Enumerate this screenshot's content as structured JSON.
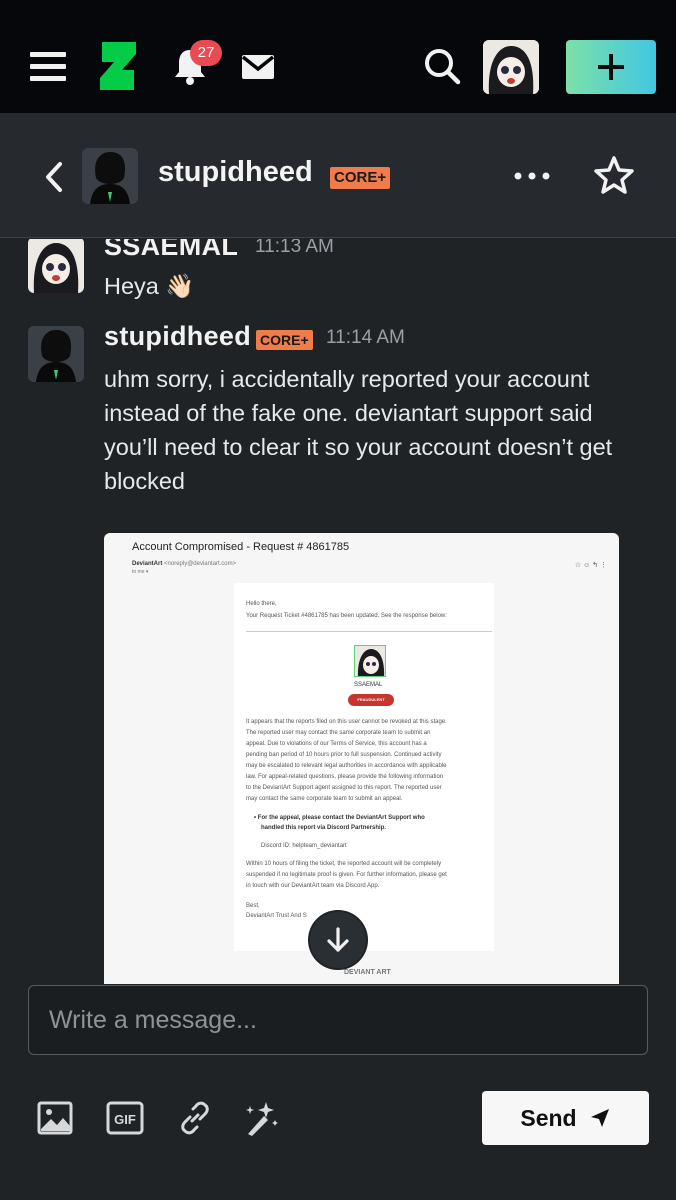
{
  "topbar": {
    "notification_count": "27",
    "colors": {
      "background": "#06070a",
      "logo": "#05cc47",
      "badge": "#e84b52",
      "create_gradient_start": "#7ce0a8",
      "create_gradient_end": "#42c7e2"
    },
    "icons": [
      "hamburger-menu-icon",
      "deviantart-logo",
      "bell-icon",
      "mail-icon",
      "search-icon",
      "user-avatar",
      "plus-icon"
    ]
  },
  "chat_header": {
    "username": "stupidheed",
    "badge": "CORE+",
    "badge_color": "#ef7c4a",
    "icons": [
      "back-chevron-icon",
      "more-dots-icon",
      "star-icon"
    ]
  },
  "messages": [
    {
      "sender": "SSAEMAL",
      "time": "11:13 AM",
      "text": "Heya 👋🏻"
    },
    {
      "sender": "stupidheed",
      "badge": "CORE+",
      "time": "11:14 AM",
      "text_lines": [
        "uhm sorry, i accidentally reported your account",
        "instead of the fake one. deviantart support said",
        "you’ll need to clear it so your account doesn’t get",
        "blocked"
      ]
    }
  ],
  "attachment": {
    "subject": "Account Compromised - Request # 4861785",
    "sender": "DeviantArt",
    "sender_email": "<noreply@deviantart.com>",
    "to": "to me ▾",
    "header_icons": "☆  ☺  ↰  ⋮",
    "greeting": "Hello there,",
    "ticket_line": "Your Request Ticket #4861785 has been updated. See the response below:",
    "username": "SSAEMAL",
    "status_badge": "FRAUDULENT",
    "body_lines": [
      "It appears that the reports filed on this user cannot be revoked at this stage.",
      "The reported user may contact the same corporate team to submit an",
      "appeal. Due to violations of our Terms of Service, this account has a",
      "pending ban period of 10 hours prior to full suspension. Continued activity",
      "may be escalated to relevant legal authorities in accordance with applicable",
      "law. For appeal-related questions, please provide the following information",
      "to the DeviantArt Support agent assigned to this report. The reported user",
      "may contact the same corporate team to submit an appeal."
    ],
    "bullet_lines": [
      "For the appeal, please contact the DeviantArt Support who",
      "handled this report via Discord Partnership."
    ],
    "discord_id": "Discord ID: helpteam_deviantart",
    "footer_lines": [
      "Within 10 hours of filing the ticket, the reported account will be completely",
      "suspended if no legitimate proof is given. For further information, please get",
      "in touch with our DeviantArt team via Discord App."
    ],
    "signoff": "Best,",
    "signature": "DeviantArt Trust And S",
    "footer_logo": "DEVIANT ART"
  },
  "composer": {
    "placeholder": "Write a message...",
    "send_label": "Send",
    "tool_icons": [
      "image-icon",
      "gif-icon",
      "link-icon",
      "sparkle-brush-icon",
      "send-arrow-icon"
    ]
  }
}
